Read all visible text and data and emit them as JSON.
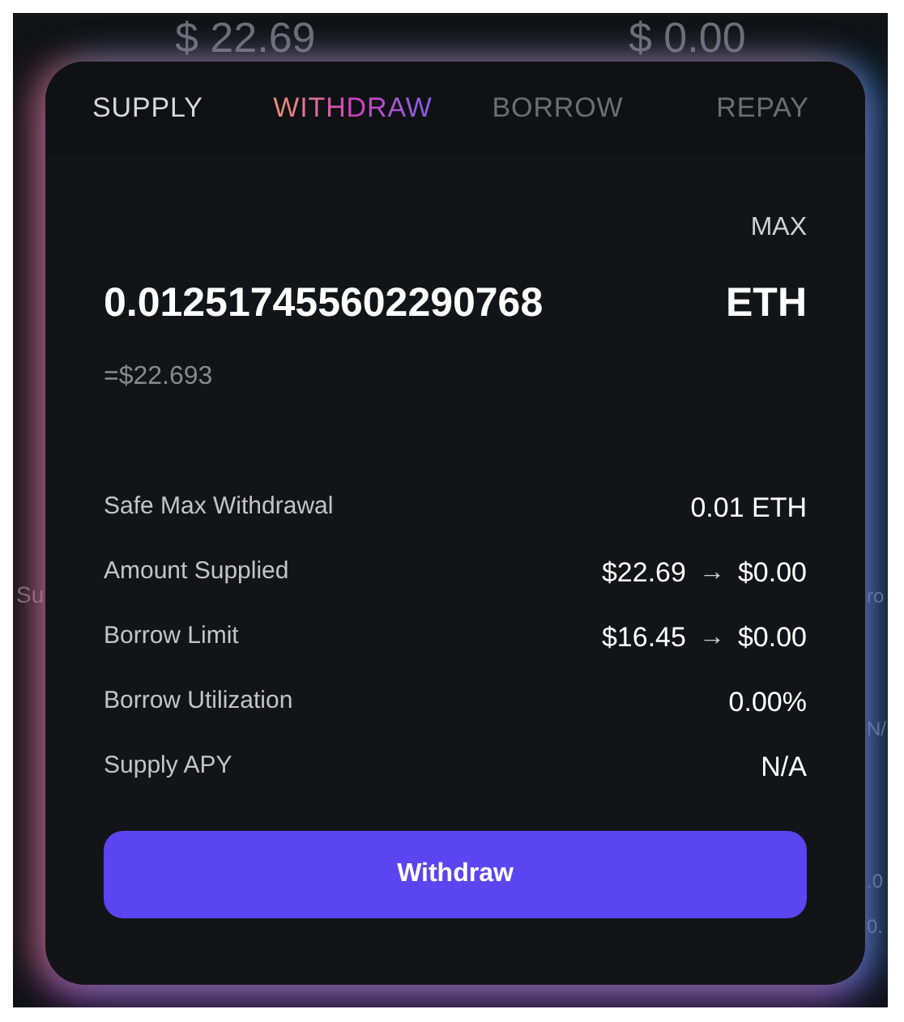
{
  "background_texts": [
    {
      "text": "$ 22.69"
    },
    {
      "text": "$ 0.00"
    },
    {
      "text": "Su"
    },
    {
      "text": "ro"
    },
    {
      "text": "N/"
    },
    {
      "text": ".0"
    },
    {
      "text": "0."
    }
  ],
  "tabs": [
    {
      "label": "SUPPLY",
      "selected": false,
      "disabled": false
    },
    {
      "label": "WITHDRAW",
      "selected": true,
      "disabled": false
    },
    {
      "label": "BORROW",
      "selected": false,
      "disabled": true
    },
    {
      "label": "REPAY",
      "selected": false,
      "disabled": true
    }
  ],
  "max_label": "MAX",
  "amount": {
    "value": "0.012517455602290768",
    "unit": "ETH",
    "usd": "=$22.693"
  },
  "details": [
    {
      "label": "Safe Max Withdrawal",
      "value": "0.01 ETH"
    },
    {
      "label": "Amount Supplied",
      "value": "$22.69",
      "arrow": "→",
      "new_value": "$0.00"
    },
    {
      "label": "Borrow Limit",
      "value": "$16.45",
      "arrow": "→",
      "new_value": "$0.00"
    },
    {
      "label": "Borrow Utilization",
      "value": "0.00%"
    },
    {
      "label": "Supply APY",
      "value": "N/A"
    }
  ],
  "button": "Withdraw"
}
